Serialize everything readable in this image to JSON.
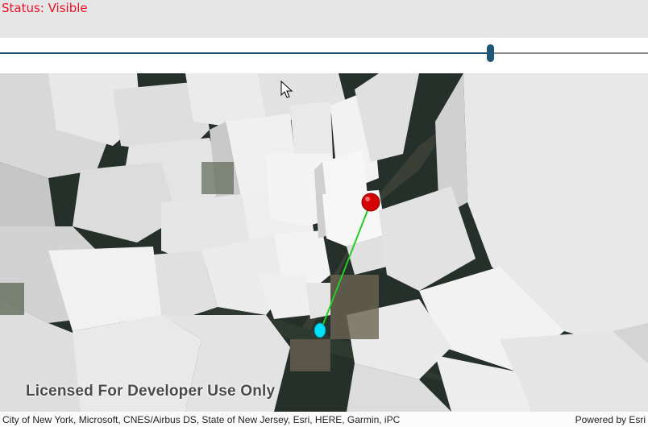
{
  "status": {
    "text": "Status: Visible",
    "color": "#e81123"
  },
  "slider": {
    "value_fraction": 0.757,
    "track_color": "#1f4e6a",
    "thumb_color": "#1f5674"
  },
  "map": {
    "watermark": "Licensed For Developer Use Only",
    "attribution": "City of New York, Microsoft, CNES/Airbus DS, State of New Jersey, Esri, HERE, Garmin, iPC",
    "powered_by": "Powered by Esri",
    "observer_color": "#d40000",
    "target_color": "#00e0ff",
    "sightline_color": "#22cc22"
  }
}
